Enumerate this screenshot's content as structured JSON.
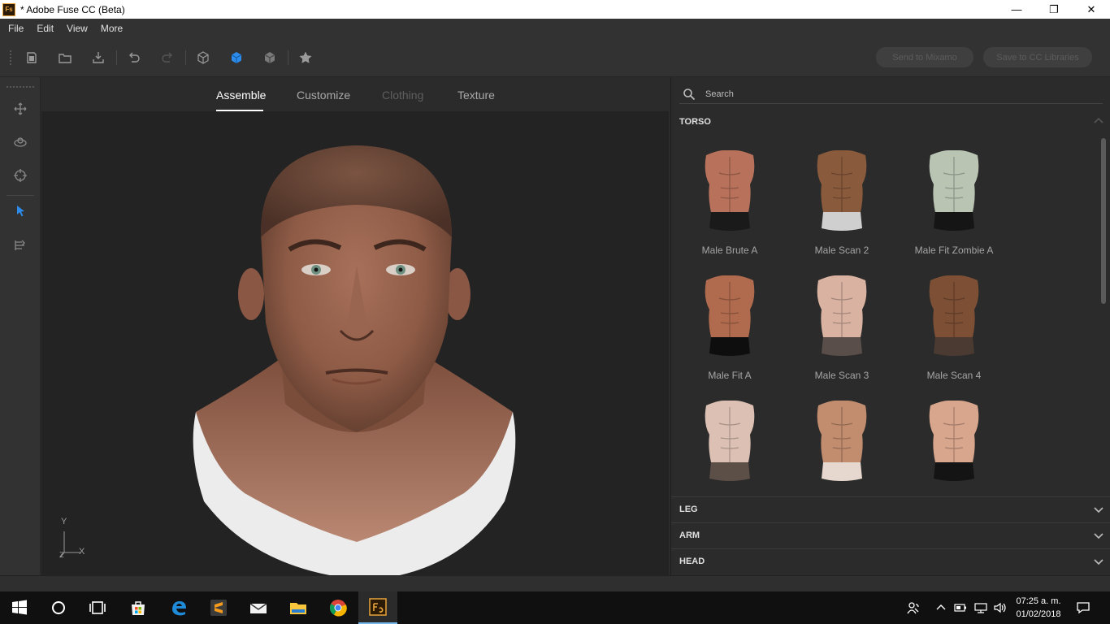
{
  "window": {
    "title": "* Adobe Fuse CC (Beta)",
    "app_icon": "Fs",
    "minimize": "—",
    "restore": "❐",
    "close": "✕"
  },
  "menu": [
    "File",
    "Edit",
    "View",
    "More"
  ],
  "toolbar": {
    "send_to_mixamo": "Send to Mixamo",
    "save_to_cc": "Save to CC Libraries"
  },
  "tabs": [
    {
      "label": "Assemble",
      "state": "active"
    },
    {
      "label": "Customize",
      "state": "normal"
    },
    {
      "label": "Clothing",
      "state": "disabled"
    },
    {
      "label": "Texture",
      "state": "normal"
    }
  ],
  "axis": {
    "y": "Y",
    "x": "X",
    "z": "Z"
  },
  "search": {
    "placeholder": "Search"
  },
  "sections": {
    "torso": "TORSO",
    "leg": "LEG",
    "arm": "ARM",
    "head": "HEAD"
  },
  "torso_items": [
    {
      "label": "Male Brute A",
      "skin": "#b8715a",
      "bottom": "#1a1a1a"
    },
    {
      "label": "Male Scan 2",
      "skin": "#8a5a3c",
      "bottom": "#cfcfcf"
    },
    {
      "label": "Male Fit Zombie A",
      "skin": "#b9c4b3",
      "bottom": "#151515"
    },
    {
      "label": "Male Fit A",
      "skin": "#b06a4e",
      "bottom": "#0e0e0e"
    },
    {
      "label": "Male Scan 3",
      "skin": "#d9b2a2",
      "bottom": "#5a4e4a"
    },
    {
      "label": "Male Scan 4",
      "skin": "#7d4f35",
      "bottom": "#4b3a32"
    },
    {
      "label": "",
      "skin": "#dcc0b3",
      "bottom": "#5c4f47"
    },
    {
      "label": "",
      "skin": "#c28c6e",
      "bottom": "#e7d8cf"
    },
    {
      "label": "",
      "skin": "#d8a58d",
      "bottom": "#141414"
    }
  ],
  "taskbar": {
    "clock_time": "07:25 a. m.",
    "clock_date": "01/02/2018",
    "apps": [
      "start-icon",
      "cortana-icon",
      "task-view-icon",
      "store-icon",
      "edge-icon",
      "sublime-icon",
      "mail-icon",
      "file-explorer-icon",
      "chrome-icon",
      "fuse-icon"
    ]
  },
  "colors": {
    "accent": "#2d8ceb",
    "panel_bg": "#2b2b2b",
    "viewport_bg": "#232323"
  }
}
